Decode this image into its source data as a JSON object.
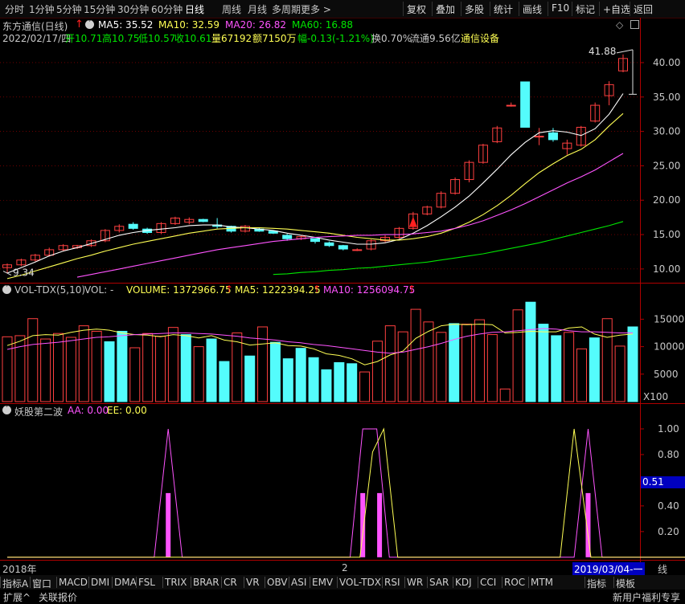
{
  "toolbar": {
    "timeframes": [
      "分时",
      "1分钟",
      "5分钟",
      "15分钟",
      "30分钟",
      "60分钟",
      "日线",
      "周线",
      "月线",
      "多周期",
      "更多 >"
    ],
    "active_timeframe": "日线",
    "right_buttons": [
      "复权",
      "叠加",
      "多股",
      "统计",
      "画线",
      "F10",
      "标记",
      "+自选",
      "返回"
    ]
  },
  "stock": {
    "title": "东方通信(日线)",
    "ma5": "MA5: 35.52",
    "ma10": "MA10: 32.59",
    "ma20": "MA20: 26.82",
    "ma60": "MA60: 16.88",
    "date": "2022/02/17/四",
    "open": "开10.71",
    "high": "高10.75",
    "low": "低10.57",
    "close": "收10.61",
    "volume": "量67192",
    "amount": "额7150万",
    "change": "幅-0.13(-1.21%)",
    "turnover": "换0.70%",
    "float_cap": "流通9.56亿",
    "sector": "通信设备"
  },
  "volume_panel": {
    "name": "VOL-TDX(5,10)",
    "vol_label": "VOL: -",
    "volume": "VOLUME: 1372966.75",
    "ma5": "MA5: 1222394.25",
    "ma10": "MA10: 1256094.75",
    "unit": "X100"
  },
  "indicator_panel": {
    "name": "妖股第二波",
    "aa": "AA: 0.00",
    "ee": "EE: 0.00",
    "current_value": "0.51"
  },
  "date_markers": [
    "2018年",
    "2",
    "2019/03/04-一"
  ],
  "axis_tag": "线",
  "bottom_tabs": [
    "指标A",
    "窗口",
    "MACD",
    "DMI",
    "DMA",
    "FSL",
    "TRIX",
    "BRAR",
    "CR",
    "VR",
    "OBV",
    "ASI",
    "EMV",
    "VOL-TDX",
    "RSI",
    "WR",
    "SAR",
    "KDJ",
    "CCI",
    "ROC",
    "MTM",
    "指标",
    "模板"
  ],
  "footer": {
    "left": [
      "扩展^",
      "关联报价"
    ],
    "right": "新用户福利专享"
  },
  "colors": {
    "up": "#ff4040",
    "down": "#54fcfc",
    "ma5": "#ffffff",
    "ma10": "#ffff54",
    "ma20": "#ff54ff",
    "ma60": "#00e600",
    "axis": "#b00000",
    "ind_aa": "#ff54ff",
    "ind_ee": "#ffff54"
  },
  "chart_data": [
    {
      "type": "candlestick",
      "title": "东方通信(日线)",
      "y_ticks": [
        10.0,
        15.0,
        20.0,
        25.0,
        30.0,
        35.0,
        40.0
      ],
      "ylim": [
        8.0,
        43.5
      ],
      "annotations": [
        {
          "label": "41.88",
          "value": 41.88
        },
        {
          "label": "9.34",
          "value": 9.34
        }
      ],
      "candles": [
        {
          "o": 10.2,
          "h": 10.8,
          "l": 9.34,
          "c": 10.6
        },
        {
          "o": 10.6,
          "h": 11.5,
          "l": 10.4,
          "c": 11.3
        },
        {
          "o": 11.3,
          "h": 12.2,
          "l": 11.1,
          "c": 12.0
        },
        {
          "o": 12.0,
          "h": 13.1,
          "l": 11.8,
          "c": 12.8
        },
        {
          "o": 12.8,
          "h": 13.6,
          "l": 12.6,
          "c": 13.4
        },
        {
          "o": 13.1,
          "h": 13.5,
          "l": 12.9,
          "c": 13.4
        },
        {
          "o": 13.4,
          "h": 14.3,
          "l": 13.2,
          "c": 14.1
        },
        {
          "o": 14.1,
          "h": 15.8,
          "l": 13.9,
          "c": 15.6
        },
        {
          "o": 15.6,
          "h": 16.5,
          "l": 15.3,
          "c": 16.2
        },
        {
          "o": 16.5,
          "h": 16.8,
          "l": 15.7,
          "c": 15.9
        },
        {
          "o": 15.8,
          "h": 16.0,
          "l": 15.1,
          "c": 15.3
        },
        {
          "o": 15.3,
          "h": 16.8,
          "l": 15.1,
          "c": 16.6
        },
        {
          "o": 16.6,
          "h": 17.6,
          "l": 16.4,
          "c": 17.4
        },
        {
          "o": 16.8,
          "h": 17.5,
          "l": 16.5,
          "c": 17.2
        },
        {
          "o": 17.2,
          "h": 17.3,
          "l": 16.8,
          "c": 16.9
        },
        {
          "o": 16.4,
          "h": 17.4,
          "l": 15.9,
          "c": 16.2
        },
        {
          "o": 16.2,
          "h": 16.3,
          "l": 15.3,
          "c": 15.5
        },
        {
          "o": 15.5,
          "h": 16.4,
          "l": 15.3,
          "c": 16.2
        },
        {
          "o": 15.8,
          "h": 16.0,
          "l": 15.4,
          "c": 15.5
        },
        {
          "o": 15.5,
          "h": 15.6,
          "l": 15.1,
          "c": 15.2
        },
        {
          "o": 14.9,
          "h": 15.1,
          "l": 14.1,
          "c": 14.4
        },
        {
          "o": 14.4,
          "h": 14.9,
          "l": 14.2,
          "c": 14.7
        },
        {
          "o": 14.4,
          "h": 14.5,
          "l": 13.7,
          "c": 14.0
        },
        {
          "o": 13.8,
          "h": 14.0,
          "l": 13.2,
          "c": 13.4
        },
        {
          "o": 13.4,
          "h": 13.5,
          "l": 12.7,
          "c": 12.9
        },
        {
          "o": 12.8,
          "h": 13.0,
          "l": 12.6,
          "c": 12.8
        },
        {
          "o": 12.9,
          "h": 14.3,
          "l": 12.7,
          "c": 14.1
        },
        {
          "o": 14.1,
          "h": 14.9,
          "l": 13.9,
          "c": 14.6
        },
        {
          "o": 14.6,
          "h": 16.1,
          "l": 14.4,
          "c": 15.9
        },
        {
          "o": 15.9,
          "h": 18.3,
          "l": 15.7,
          "c": 18.0
        },
        {
          "o": 18.0,
          "h": 19.2,
          "l": 17.8,
          "c": 19.0
        },
        {
          "o": 19.0,
          "h": 21.3,
          "l": 18.8,
          "c": 21.0
        },
        {
          "o": 21.0,
          "h": 23.3,
          "l": 20.8,
          "c": 23.0
        },
        {
          "o": 23.0,
          "h": 25.8,
          "l": 22.6,
          "c": 25.5
        },
        {
          "o": 25.5,
          "h": 28.2,
          "l": 25.3,
          "c": 28.0
        },
        {
          "o": 28.5,
          "h": 30.8,
          "l": 28.3,
          "c": 30.5
        },
        {
          "o": 33.8,
          "h": 34.2,
          "l": 33.6,
          "c": 33.8
        },
        {
          "o": 37.2,
          "h": 37.2,
          "l": 30.6,
          "c": 30.6
        },
        {
          "o": 29.3,
          "h": 30.5,
          "l": 28.0,
          "c": 29.3
        },
        {
          "o": 29.8,
          "h": 30.5,
          "l": 28.5,
          "c": 28.8
        },
        {
          "o": 27.5,
          "h": 28.8,
          "l": 26.6,
          "c": 28.3
        },
        {
          "o": 28.0,
          "h": 30.8,
          "l": 27.8,
          "c": 30.6
        },
        {
          "o": 31.5,
          "h": 34.2,
          "l": 31.3,
          "c": 33.8
        },
        {
          "o": 35.2,
          "h": 37.3,
          "l": 33.8,
          "c": 36.8
        },
        {
          "o": 38.8,
          "h": 41.2,
          "l": 38.6,
          "c": 40.6
        }
      ],
      "series": [
        {
          "name": "MA5",
          "values": [
            9.4,
            10.2,
            11.0,
            11.9,
            12.6,
            13.1,
            13.7,
            14.3,
            14.9,
            15.3,
            15.6,
            15.8,
            16.0,
            16.3,
            16.4,
            16.4,
            16.1,
            16.0,
            15.8,
            15.6,
            15.2,
            14.9,
            14.6,
            14.2,
            13.9,
            13.6,
            13.6,
            13.8,
            14.3,
            15.2,
            16.3,
            17.6,
            19.0,
            20.6,
            22.5,
            24.5,
            26.6,
            28.4,
            29.8,
            30.1,
            29.9,
            29.4,
            30.4,
            32.5,
            35.5
          ]
        },
        {
          "name": "MA10",
          "values": [
            8.6,
            9.1,
            9.7,
            10.3,
            10.9,
            11.5,
            12.0,
            12.6,
            13.1,
            13.6,
            14.0,
            14.4,
            14.8,
            15.2,
            15.5,
            15.8,
            15.9,
            16.0,
            16.0,
            15.9,
            15.8,
            15.6,
            15.4,
            15.2,
            14.9,
            14.6,
            14.4,
            14.2,
            14.2,
            14.4,
            14.7,
            15.2,
            15.9,
            16.8,
            17.9,
            19.2,
            20.7,
            22.4,
            24.0,
            25.3,
            26.5,
            27.4,
            28.8,
            30.8,
            32.6
          ]
        },
        {
          "name": "MA20",
          "values": [
            null,
            null,
            null,
            null,
            null,
            8.8,
            9.2,
            9.6,
            10.0,
            10.4,
            10.8,
            11.2,
            11.6,
            12.0,
            12.4,
            12.8,
            13.1,
            13.4,
            13.7,
            14.0,
            14.2,
            14.4,
            14.6,
            14.7,
            14.8,
            14.9,
            14.9,
            15.0,
            15.0,
            15.1,
            15.3,
            15.5,
            15.9,
            16.4,
            17.0,
            17.8,
            18.6,
            19.5,
            20.5,
            21.5,
            22.5,
            23.4,
            24.4,
            25.6,
            26.8
          ]
        },
        {
          "name": "MA60",
          "values": [
            null,
            null,
            null,
            null,
            null,
            null,
            null,
            null,
            null,
            null,
            null,
            null,
            null,
            null,
            null,
            null,
            null,
            null,
            null,
            9.2,
            9.3,
            9.5,
            9.6,
            9.8,
            9.9,
            10.1,
            10.2,
            10.4,
            10.6,
            10.8,
            11.0,
            11.3,
            11.6,
            11.9,
            12.2,
            12.6,
            13.0,
            13.4,
            13.8,
            14.3,
            14.8,
            15.3,
            15.8,
            16.3,
            16.9
          ]
        }
      ]
    },
    {
      "type": "bar",
      "title": "VOL-TDX(5,10)",
      "y_ticks": [
        5000,
        10000,
        15000
      ],
      "ylim": [
        0,
        19300
      ],
      "values": [
        11800,
        12000,
        15100,
        11400,
        12400,
        11700,
        13800,
        12800,
        10900,
        12800,
        9800,
        12400,
        11900,
        13500,
        12200,
        10000,
        11400,
        7300,
        12500,
        8300,
        13600,
        10800,
        7800,
        9700,
        8000,
        5800,
        7100,
        6900,
        5400,
        11000,
        13800,
        12700,
        16800,
        14500,
        12600,
        14200,
        14100,
        14900,
        12200,
        2300,
        16700,
        18100,
        14100,
        12000,
        12600,
        9600,
        11600,
        15100,
        10100,
        13600
      ],
      "series": [
        {
          "name": "MA5",
          "values": [
            10200,
            11000,
            12000,
            12200,
            12100,
            12600,
            13000,
            13200,
            13000,
            12500,
            12200,
            12100,
            11800,
            12200,
            12000,
            11600,
            12000,
            11200,
            10900,
            10300,
            10500,
            10700,
            10200,
            10100,
            9600,
            8700,
            8400,
            7800,
            6700,
            7300,
            8500,
            9200,
            11500,
            12800,
            13800,
            14100,
            14000,
            14100,
            14000,
            12500,
            12600,
            12800,
            12700,
            12700,
            13400,
            13600,
            12300,
            11700,
            12100,
            12300
          ]
        },
        {
          "name": "MA10",
          "values": [
            9500,
            10000,
            10400,
            10600,
            10800,
            11100,
            11400,
            11700,
            11800,
            12000,
            12200,
            12300,
            12400,
            12500,
            12500,
            12400,
            12300,
            12100,
            11900,
            11600,
            11400,
            11200,
            10900,
            10700,
            10400,
            10200,
            9900,
            9600,
            9300,
            9000,
            8800,
            9000,
            9500,
            10000,
            10600,
            11300,
            11900,
            12300,
            12600,
            12700,
            12900,
            13100,
            13300,
            13200,
            12900,
            12700,
            12700,
            12600,
            12500,
            12500
          ]
        }
      ]
    },
    {
      "type": "line",
      "title": "妖股第二波",
      "y_ticks": [
        0.2,
        0.4,
        0.6,
        0.8,
        1.0
      ],
      "ylim": [
        -0.02,
        1.1
      ],
      "series": [
        {
          "name": "AA",
          "points": [
            [
              0,
              0
            ],
            [
              10.5,
              0
            ],
            [
              11.5,
              1
            ],
            [
              12.5,
              0
            ],
            [
              24.5,
              0
            ],
            [
              25.4,
              1
            ],
            [
              26.4,
              1
            ],
            [
              27.3,
              0
            ],
            [
              40.5,
              0
            ],
            [
              41.5,
              1
            ],
            [
              42.5,
              0
            ],
            [
              49.5,
              0
            ]
          ]
        },
        {
          "name": "EE",
          "points": [
            [
              0,
              0
            ],
            [
              25.2,
              0
            ],
            [
              26.1,
              0.82
            ],
            [
              26.9,
              1
            ],
            [
              27.9,
              0
            ],
            [
              39.5,
              0
            ],
            [
              40.5,
              1
            ],
            [
              41.7,
              0
            ],
            [
              49.5,
              0
            ]
          ]
        }
      ],
      "bars": [
        {
          "x": 11.5,
          "value": 0.5
        },
        {
          "x": 25.4,
          "value": 0.5
        },
        {
          "x": 26.6,
          "value": 0.5
        },
        {
          "x": 41.5,
          "value": 0.5
        }
      ]
    }
  ]
}
